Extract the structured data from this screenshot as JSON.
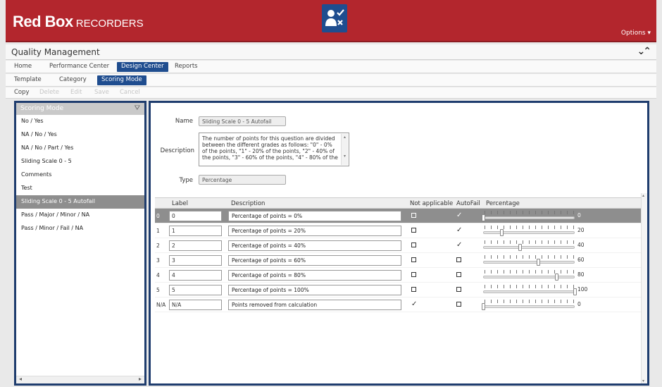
{
  "header": {
    "brand": "Red Box",
    "brand_sub": "RECORDERS",
    "options": "Options ▾",
    "app_icon": "user-check-icon"
  },
  "module": {
    "title": "Quality Management",
    "collapse_glyph": "⌄⌃"
  },
  "nav": {
    "tabs": [
      "Home",
      "Performance Center",
      "Design Center",
      "Reports"
    ],
    "active": "Design Center"
  },
  "subnav": {
    "tabs": [
      "Template",
      "Category",
      "Scoring Mode"
    ],
    "active": "Scoring Mode"
  },
  "actions": {
    "items": [
      "Copy",
      "Delete",
      "Edit",
      "Save",
      "Cancel"
    ]
  },
  "sidebar": {
    "header": "Scoring Mode",
    "items": [
      "No / Yes",
      "NA / No / Yes",
      "NA / No / Part / Yes",
      "Sliding Scale 0 - 5",
      "Comments",
      "Test",
      "Sliding Scale 0 - 5 Autofail",
      "Pass / Major / Minor / NA",
      "Pass / Minor / Fail / NA"
    ],
    "selected_index": 6
  },
  "form": {
    "name_label": "Name",
    "name_value": "Sliding Scale 0 - 5 Autofail",
    "description_label": "Description",
    "description_value": "The number of points for this question are divided between the different grades as follows: \"0\" - 0% of the points, \"1\" - 20% of the points, \"2\" - 40% of the points, \"3\" - 60% of the points, \"4\" - 80% of the",
    "type_label": "Type",
    "type_value": "Percentage"
  },
  "grid": {
    "columns": [
      "Label",
      "Description",
      "Not applicable",
      "AutoFail",
      "Percentage"
    ],
    "rows": [
      {
        "index": "0",
        "label": "0",
        "description": "Percentage of points = 0%",
        "not_applicable": false,
        "autofail": true,
        "percentage": 0,
        "percentage_text": "0"
      },
      {
        "index": "1",
        "label": "1",
        "description": "Percentage of points = 20%",
        "not_applicable": false,
        "autofail": true,
        "percentage": 20,
        "percentage_text": "20"
      },
      {
        "index": "2",
        "label": "2",
        "description": "Percentage of points = 40%",
        "not_applicable": false,
        "autofail": true,
        "percentage": 40,
        "percentage_text": "40"
      },
      {
        "index": "3",
        "label": "3",
        "description": "Percentage of points = 60%",
        "not_applicable": false,
        "autofail": false,
        "percentage": 60,
        "percentage_text": "60"
      },
      {
        "index": "4",
        "label": "4",
        "description": "Percentage of points = 80%",
        "not_applicable": false,
        "autofail": false,
        "percentage": 80,
        "percentage_text": "80"
      },
      {
        "index": "5",
        "label": "5",
        "description": "Percentage of points = 100%",
        "not_applicable": false,
        "autofail": false,
        "percentage": 100,
        "percentage_text": "100"
      },
      {
        "index": "N/A",
        "label": "N/A",
        "description": "Points removed from calculation",
        "not_applicable": true,
        "autofail": false,
        "percentage": 0,
        "percentage_text": "0"
      }
    ],
    "selected_index": 0
  },
  "colors": {
    "brand_red": "#b3262d",
    "accent_blue": "#1f4d8f",
    "selection_gray": "#8e8e8e"
  }
}
